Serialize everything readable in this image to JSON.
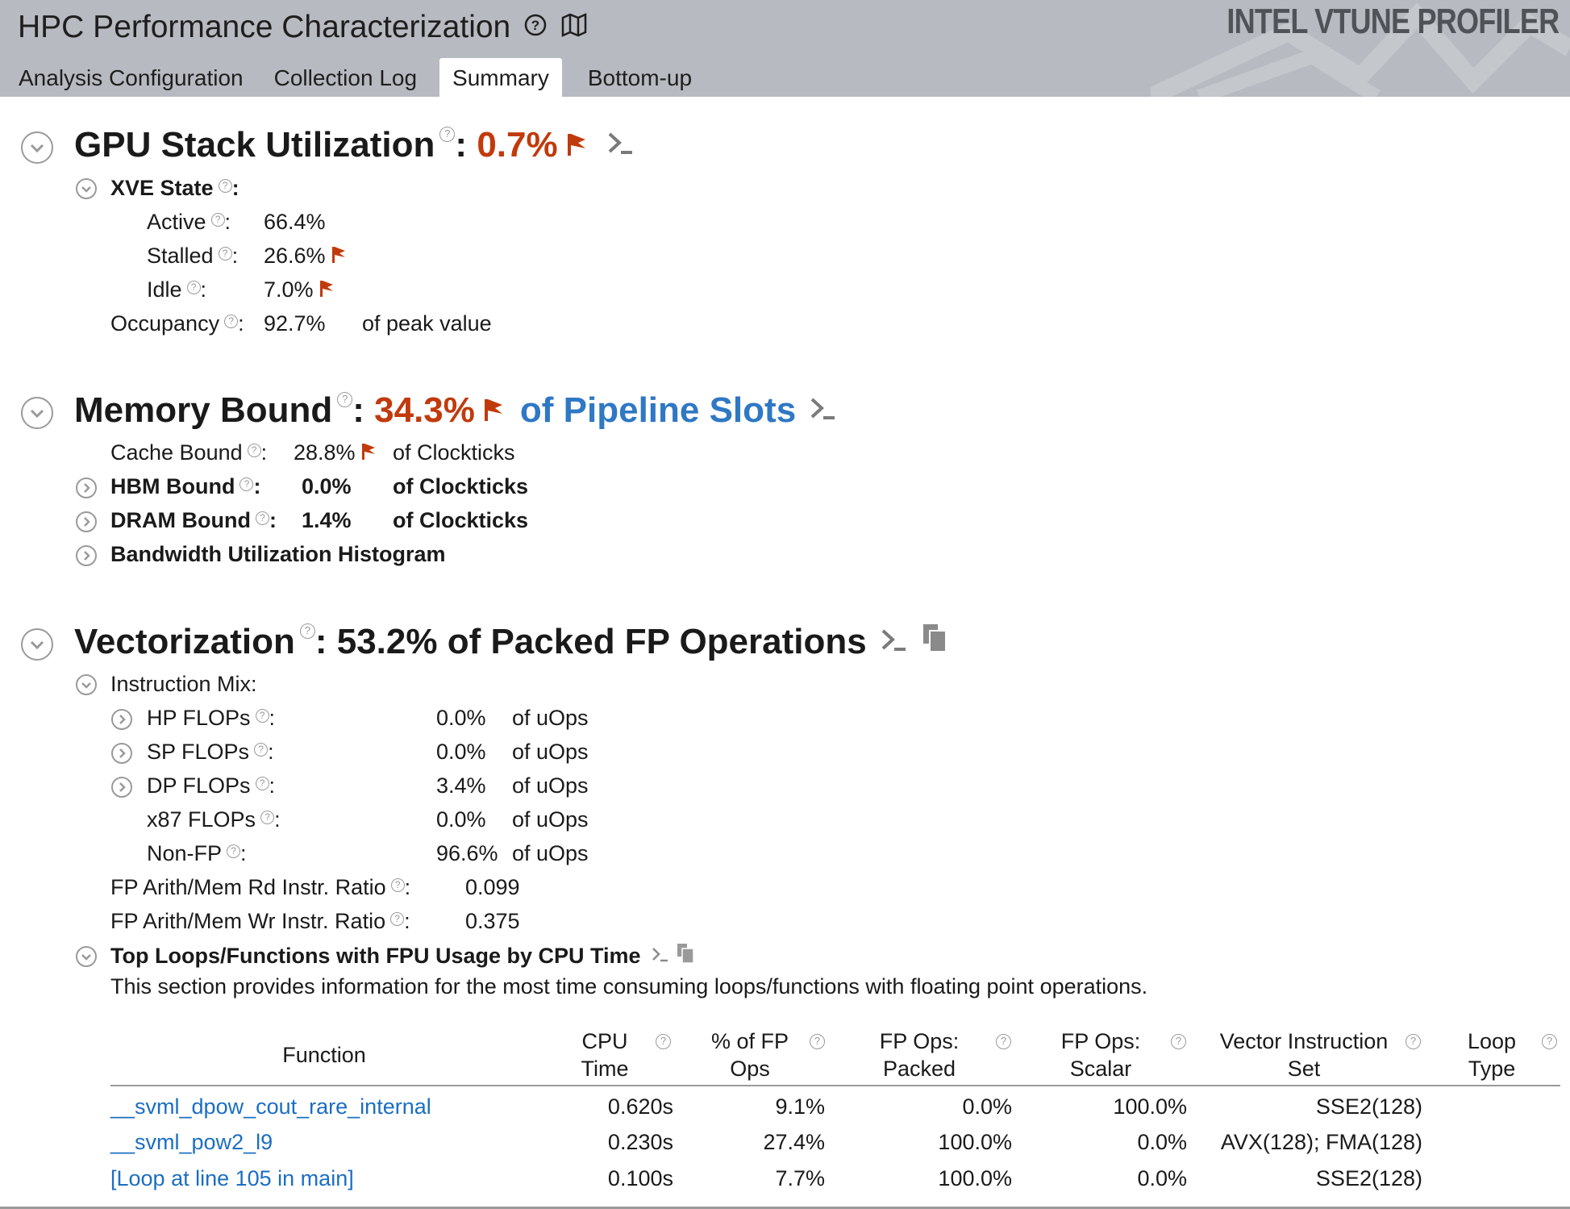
{
  "header": {
    "title": "HPC Performance Characterization",
    "brand": "INTEL VTUNE PROFILER",
    "tabs": [
      "Analysis Configuration",
      "Collection Log",
      "Summary",
      "Bottom-up"
    ],
    "active_tab": "Summary"
  },
  "gpu": {
    "title": "GPU Stack Utilization",
    "value": "0.7%",
    "xve_label": "XVE State",
    "active_label": "Active",
    "active_value": "66.4%",
    "stalled_label": "Stalled",
    "stalled_value": "26.6%",
    "idle_label": "Idle",
    "idle_value": "7.0%",
    "occupancy_label": "Occupancy",
    "occupancy_value": "92.7%",
    "occupancy_unit": "of peak value"
  },
  "memory": {
    "title": "Memory Bound",
    "value": "34.3%",
    "unit": "of Pipeline Slots",
    "cache_label": "Cache Bound",
    "cache_value": "28.8%",
    "cache_unit": "of Clockticks",
    "hbm_label": "HBM Bound",
    "hbm_value": "0.0%",
    "hbm_unit": "of Clockticks",
    "dram_label": "DRAM Bound",
    "dram_value": "1.4%",
    "dram_unit": "of Clockticks",
    "histogram_label": "Bandwidth Utilization Histogram"
  },
  "vectorization": {
    "title": "Vectorization",
    "value_text": ": 53.2% of Packed FP Operations",
    "mix_label": "Instruction Mix:",
    "hp_label": "HP FLOPs",
    "hp_value": "0.0%",
    "sp_label": "SP FLOPs",
    "sp_value": "0.0%",
    "dp_label": "DP FLOPs",
    "dp_value": "3.4%",
    "x87_label": "x87 FLOPs",
    "x87_value": "0.0%",
    "nonfp_label": "Non-FP",
    "nonfp_value": "96.6%",
    "uops_unit": "of uOps",
    "rd_label": "FP Arith/Mem Rd Instr. Ratio",
    "rd_value": "0.099",
    "wr_label": "FP Arith/Mem Wr Instr. Ratio",
    "wr_value": "0.375",
    "top_title": "Top Loops/Functions with FPU Usage by CPU Time",
    "top_desc": "This section provides information for the most time consuming loops/functions with floating point operations."
  },
  "table": {
    "headers": {
      "function": "Function",
      "cpu_time_1": "CPU",
      "cpu_time_2": "Time",
      "fp_ops_1": "% of FP",
      "fp_ops_2": "Ops",
      "packed_1": "FP Ops:",
      "packed_2": "Packed",
      "scalar_1": "FP Ops:",
      "scalar_2": "Scalar",
      "vis_1": "Vector Instruction",
      "vis_2": "Set",
      "loop_1": "Loop",
      "loop_2": "Type"
    },
    "rows": [
      {
        "function": "__svml_dpow_cout_rare_internal",
        "cpu": "0.620s",
        "fp": "9.1%",
        "packed": "0.0%",
        "scalar": "100.0%",
        "vis": "SSE2(128)",
        "loop": ""
      },
      {
        "function": "__svml_pow2_l9",
        "cpu": "0.230s",
        "fp": "27.4%",
        "packed": "100.0%",
        "scalar": "0.0%",
        "vis": "AVX(128); FMA(128)",
        "loop": ""
      },
      {
        "function": "[Loop at line 105 in main]",
        "cpu": "0.100s",
        "fp": "7.7%",
        "packed": "100.0%",
        "scalar": "0.0%",
        "vis": "SSE2(128)",
        "loop": ""
      }
    ]
  },
  "colors": {
    "header_bg": "#b7bac0",
    "accent_red": "#c13a0c",
    "accent_blue": "#2f78c4",
    "link": "#1b6ec2"
  }
}
